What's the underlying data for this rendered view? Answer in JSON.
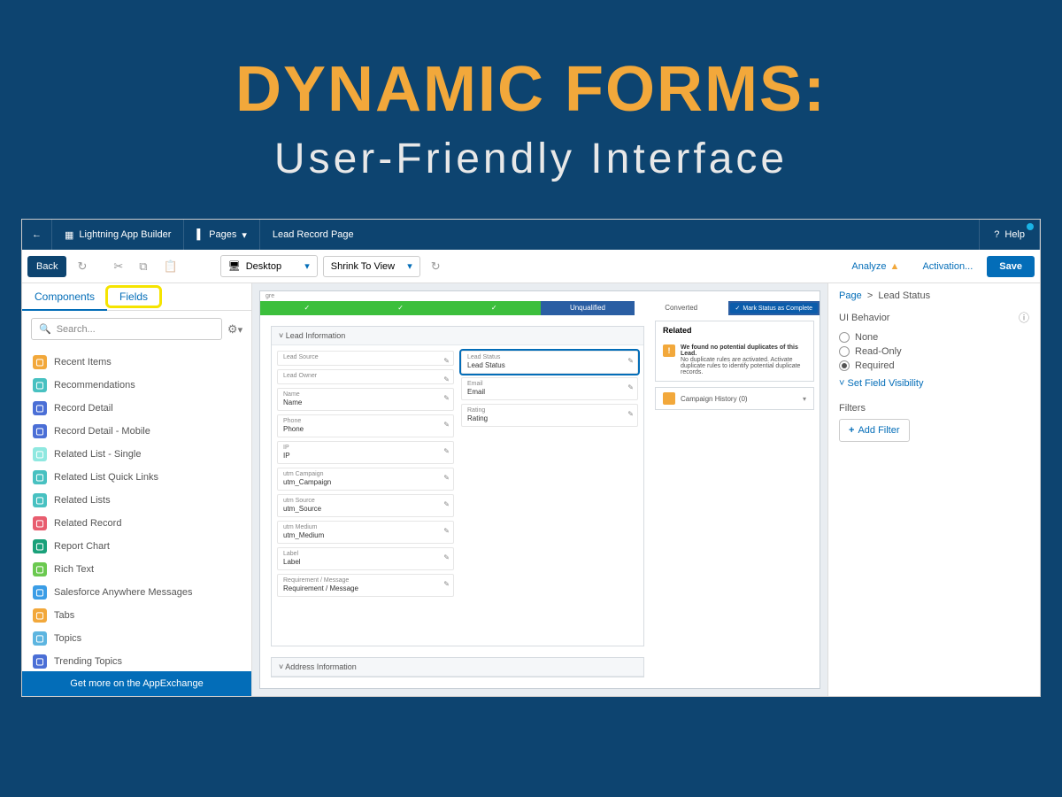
{
  "hero": {
    "title": "DYNAMIC FORMS:",
    "subtitle": "User-Friendly Interface"
  },
  "topnav": {
    "app_name": "Lightning App Builder",
    "pages_label": "Pages",
    "page_name": "Lead Record Page",
    "help_label": "Help"
  },
  "toolbar": {
    "back_label": "Back",
    "device_label": "Desktop",
    "zoom_label": "Shrink To View",
    "analyze_label": "Analyze",
    "activation_label": "Activation...",
    "save_label": "Save"
  },
  "left": {
    "tabs": {
      "components": "Components",
      "fields": "Fields"
    },
    "search_placeholder": "Search...",
    "components": [
      {
        "label": "Recent Items",
        "color": "#f2a83b"
      },
      {
        "label": "Recommendations",
        "color": "#48c1c1"
      },
      {
        "label": "Record Detail",
        "color": "#4b6fd6"
      },
      {
        "label": "Record Detail - Mobile",
        "color": "#4b6fd6"
      },
      {
        "label": "Related List - Single",
        "color": "#8fe8e0"
      },
      {
        "label": "Related List Quick Links",
        "color": "#48c1c1"
      },
      {
        "label": "Related Lists",
        "color": "#48c1c1"
      },
      {
        "label": "Related Record",
        "color": "#e85d6f"
      },
      {
        "label": "Report Chart",
        "color": "#1aa17a"
      },
      {
        "label": "Rich Text",
        "color": "#6bc950"
      },
      {
        "label": "Salesforce Anywhere Messages",
        "color": "#3b9de6"
      },
      {
        "label": "Tabs",
        "color": "#f2a83b"
      },
      {
        "label": "Topics",
        "color": "#5db5e0"
      },
      {
        "label": "Trending Topics",
        "color": "#4b6fd6"
      }
    ],
    "appex_label": "Get more on the AppExchange"
  },
  "canvas": {
    "path": {
      "steps": [
        "",
        "",
        "",
        "Unqualified",
        "Converted"
      ],
      "complete_label": "Mark Status as Complete"
    },
    "lead_section": "Lead Information",
    "fields_left": [
      {
        "label": "Lead Source",
        "value": ""
      },
      {
        "label": "Lead Owner",
        "value": ""
      },
      {
        "label": "Name",
        "value": "Name"
      },
      {
        "label": "Phone",
        "value": "Phone"
      },
      {
        "label": "IP",
        "value": "IP"
      },
      {
        "label": "utm Campaign",
        "value": "utm_Campaign"
      },
      {
        "label": "utm Source",
        "value": "utm_Source"
      },
      {
        "label": "utm Medium",
        "value": "utm_Medium"
      },
      {
        "label": "Label",
        "value": "Label"
      },
      {
        "label": "Requirement / Message",
        "value": "Requirement / Message"
      }
    ],
    "fields_right": [
      {
        "label": "Lead Status",
        "value": "Lead Status",
        "selected": true
      },
      {
        "label": "Email",
        "value": "Email"
      },
      {
        "label": "Rating",
        "value": "Rating"
      }
    ],
    "related": {
      "header": "Related",
      "alert_title": "We found no potential duplicates of this Lead.",
      "alert_sub": "No duplicate rules are activated. Activate duplicate rules to identify potential duplicate records.",
      "campaign_history": "Campaign History (0)"
    },
    "address_section": "Address Information"
  },
  "right": {
    "crumb_page": "Page",
    "crumb_current": "Lead Status",
    "behavior_label": "UI Behavior",
    "behavior_options": [
      "None",
      "Read-Only",
      "Required"
    ],
    "behavior_selected": "Required",
    "set_visibility": "Set Field Visibility",
    "filters_label": "Filters",
    "add_filter": "Add Filter"
  }
}
